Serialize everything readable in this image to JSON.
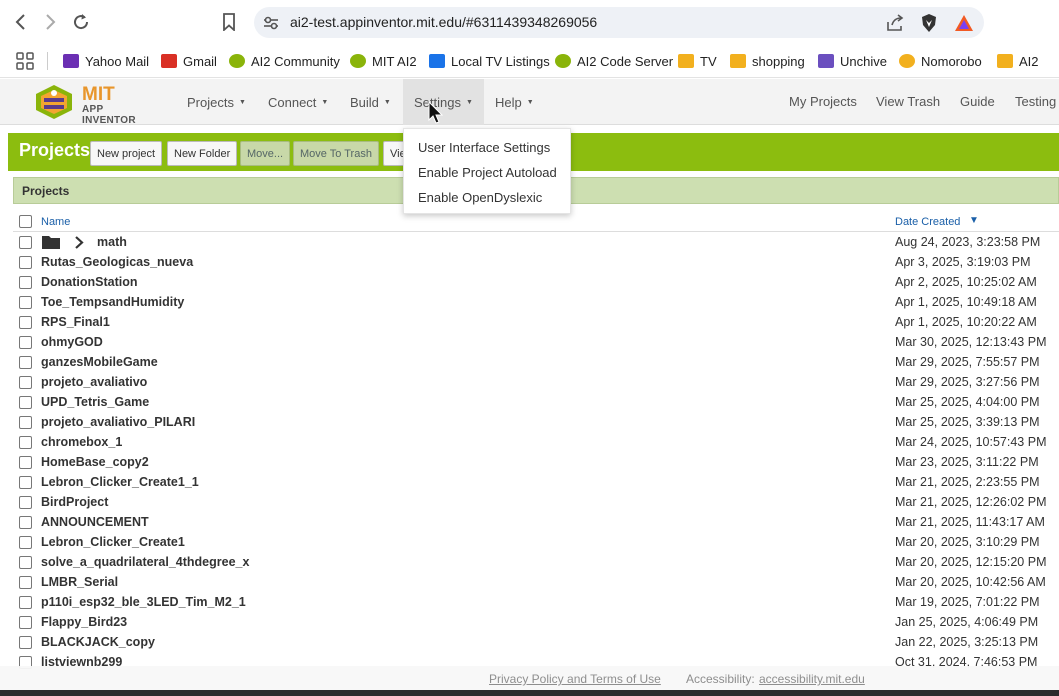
{
  "browser": {
    "url": "ai2-test.appinventor.mit.edu/#6311439348269056",
    "bookmarks": [
      {
        "label": "Yahoo Mail",
        "icon": "yahoo-mail-icon",
        "color": "#6b2fb3"
      },
      {
        "label": "Gmail",
        "icon": "gmail-icon",
        "color": "#d93025"
      },
      {
        "label": "AI2 Community",
        "icon": "ai2-community-icon",
        "color": "#8ab40a"
      },
      {
        "label": "MIT AI2",
        "icon": "mit-ai2-icon",
        "color": "#8ab40a"
      },
      {
        "label": "Local TV Listings",
        "icon": "tv-listings-icon",
        "color": "#1a73e8"
      },
      {
        "label": "AI2 Code Server",
        "icon": "code-server-icon",
        "color": "#8ab40a"
      },
      {
        "label": "TV",
        "icon": "folder-icon",
        "color": "#f2b01e"
      },
      {
        "label": "shopping",
        "icon": "folder-icon",
        "color": "#f2b01e"
      },
      {
        "label": "Unchive",
        "icon": "unchive-icon",
        "color": "#6b4fbf"
      },
      {
        "label": "Nomorobo",
        "icon": "nomorobo-icon",
        "color": "#f2b01e"
      },
      {
        "label": "AI2",
        "icon": "folder-icon",
        "color": "#f2b01e"
      }
    ]
  },
  "app": {
    "logo_mit": "MIT",
    "logo_sub": "APP INVENTOR",
    "menus": [
      "Projects",
      "Connect",
      "Build",
      "Settings",
      "Help"
    ],
    "right_links": [
      "My Projects",
      "View Trash",
      "Guide",
      "Testing"
    ],
    "accent": "#8cbd0f"
  },
  "toolbar": {
    "title": "Projects",
    "buttons": [
      "New project",
      "New Folder",
      "Move...",
      "Move To Trash",
      "Vie"
    ]
  },
  "settings_menu": [
    "User Interface Settings",
    "Enable Project Autoload",
    "Enable OpenDyslexic"
  ],
  "panel": {
    "title": "Projects"
  },
  "table": {
    "col_name": "Name",
    "col_date": "Date Created",
    "sort_indicator": "▼",
    "rows": [
      {
        "name": "math",
        "date": "Aug 24, 2023, 3:23:58 PM"
      },
      {
        "name": "Rutas_Geologicas_nueva",
        "date": "Apr 3, 2025, 3:19:03 PM"
      },
      {
        "name": "DonationStation",
        "date": "Apr 2, 2025, 10:25:02 AM"
      },
      {
        "name": "Toe_TempsandHumidity",
        "date": "Apr 1, 2025, 10:49:18 AM"
      },
      {
        "name": "RPS_Final1",
        "date": "Apr 1, 2025, 10:20:22 AM"
      },
      {
        "name": "ohmyGOD",
        "date": "Mar 30, 2025, 12:13:43 PM"
      },
      {
        "name": "ganzesMobileGame",
        "date": "Mar 29, 2025, 7:55:57 PM"
      },
      {
        "name": "projeto_avaliativo",
        "date": "Mar 29, 2025, 3:27:56 PM"
      },
      {
        "name": "UPD_Tetris_Game",
        "date": "Mar 25, 2025, 4:04:00 PM"
      },
      {
        "name": "projeto_avaliativo_PILARI",
        "date": "Mar 25, 2025, 3:39:13 PM"
      },
      {
        "name": "chromebox_1",
        "date": "Mar 24, 2025, 10:57:43 PM"
      },
      {
        "name": "HomeBase_copy2",
        "date": "Mar 23, 2025, 3:11:22 PM"
      },
      {
        "name": "Lebron_Clicker_Create1_1",
        "date": "Mar 21, 2025, 2:23:55 PM"
      },
      {
        "name": "BirdProject",
        "date": "Mar 21, 2025, 12:26:02 PM"
      },
      {
        "name": "ANNOUNCEMENT",
        "date": "Mar 21, 2025, 11:43:17 AM"
      },
      {
        "name": "Lebron_Clicker_Create1",
        "date": "Mar 20, 2025, 3:10:29 PM"
      },
      {
        "name": "solve_a_quadrilateral_4thdegree_x",
        "date": "Mar 20, 2025, 12:15:20 PM"
      },
      {
        "name": "LMBR_Serial",
        "date": "Mar 20, 2025, 10:42:56 AM"
      },
      {
        "name": "p110i_esp32_ble_3LED_Tim_M2_1",
        "date": "Mar 19, 2025, 7:01:22 PM"
      },
      {
        "name": "Flappy_Bird23",
        "date": "Jan 25, 2025, 4:06:49 PM"
      },
      {
        "name": "BLACKJACK_copy",
        "date": "Jan 22, 2025, 3:25:13 PM"
      },
      {
        "name": "listviewnb299",
        "date": "Oct 31, 2024, 7:46:53 PM"
      }
    ]
  },
  "footer": {
    "privacy": "Privacy Policy and Terms of Use",
    "access_label": "Accessibility:",
    "access_link": "accessibility.mit.edu"
  }
}
